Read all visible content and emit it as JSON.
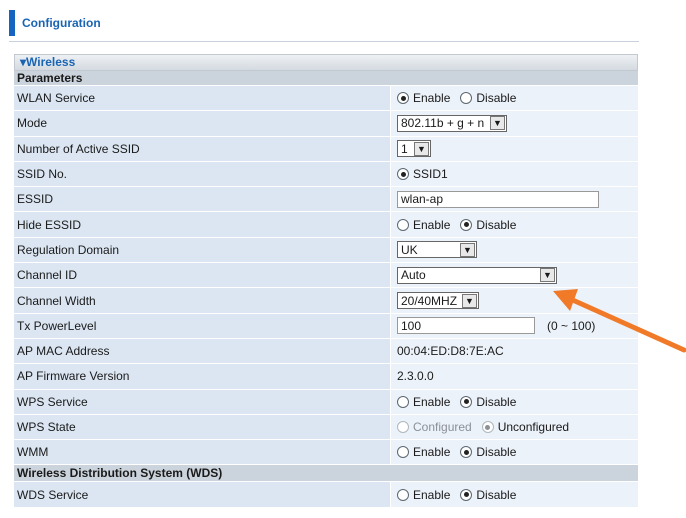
{
  "header": {
    "title": "Configuration"
  },
  "section": {
    "title": "▾Wireless"
  },
  "params_header": "Parameters",
  "rows": {
    "wlan_service": {
      "label": "WLAN Service",
      "opt1": "Enable",
      "opt2": "Disable"
    },
    "mode": {
      "label": "Mode",
      "value": "802.11b + g + n"
    },
    "active_ssid": {
      "label": "Number of Active SSID",
      "value": "1"
    },
    "ssid_no": {
      "label": "SSID No.",
      "value": "SSID1"
    },
    "essid": {
      "label": "ESSID",
      "value": "wlan-ap"
    },
    "hide_essid": {
      "label": "Hide ESSID",
      "opt1": "Enable",
      "opt2": "Disable"
    },
    "regulation": {
      "label": "Regulation Domain",
      "value": "UK"
    },
    "channel_id": {
      "label": "Channel ID",
      "value": "Auto"
    },
    "channel_width": {
      "label": "Channel Width",
      "value": "20/40MHZ"
    },
    "tx_power": {
      "label": "Tx PowerLevel",
      "value": "100",
      "hint": "(0 ~ 100)"
    },
    "ap_mac": {
      "label": "AP MAC Address",
      "value": "00:04:ED:D8:7E:AC"
    },
    "ap_fw": {
      "label": "AP Firmware Version",
      "value": "2.3.0.0"
    },
    "wps_service": {
      "label": "WPS Service",
      "opt1": "Enable",
      "opt2": "Disable"
    },
    "wps_state": {
      "label": "WPS State",
      "opt1": "Configured",
      "opt2": "Unconfigured"
    },
    "wmm": {
      "label": "WMM",
      "opt1": "Enable",
      "opt2": "Disable"
    }
  },
  "wds_header": "Wireless Distribution System (WDS)",
  "wds_service": {
    "label": "WDS Service",
    "opt1": "Enable",
    "opt2": "Disable"
  },
  "colors": {
    "accent": "#1565c0",
    "arrow": "#f07a28"
  }
}
